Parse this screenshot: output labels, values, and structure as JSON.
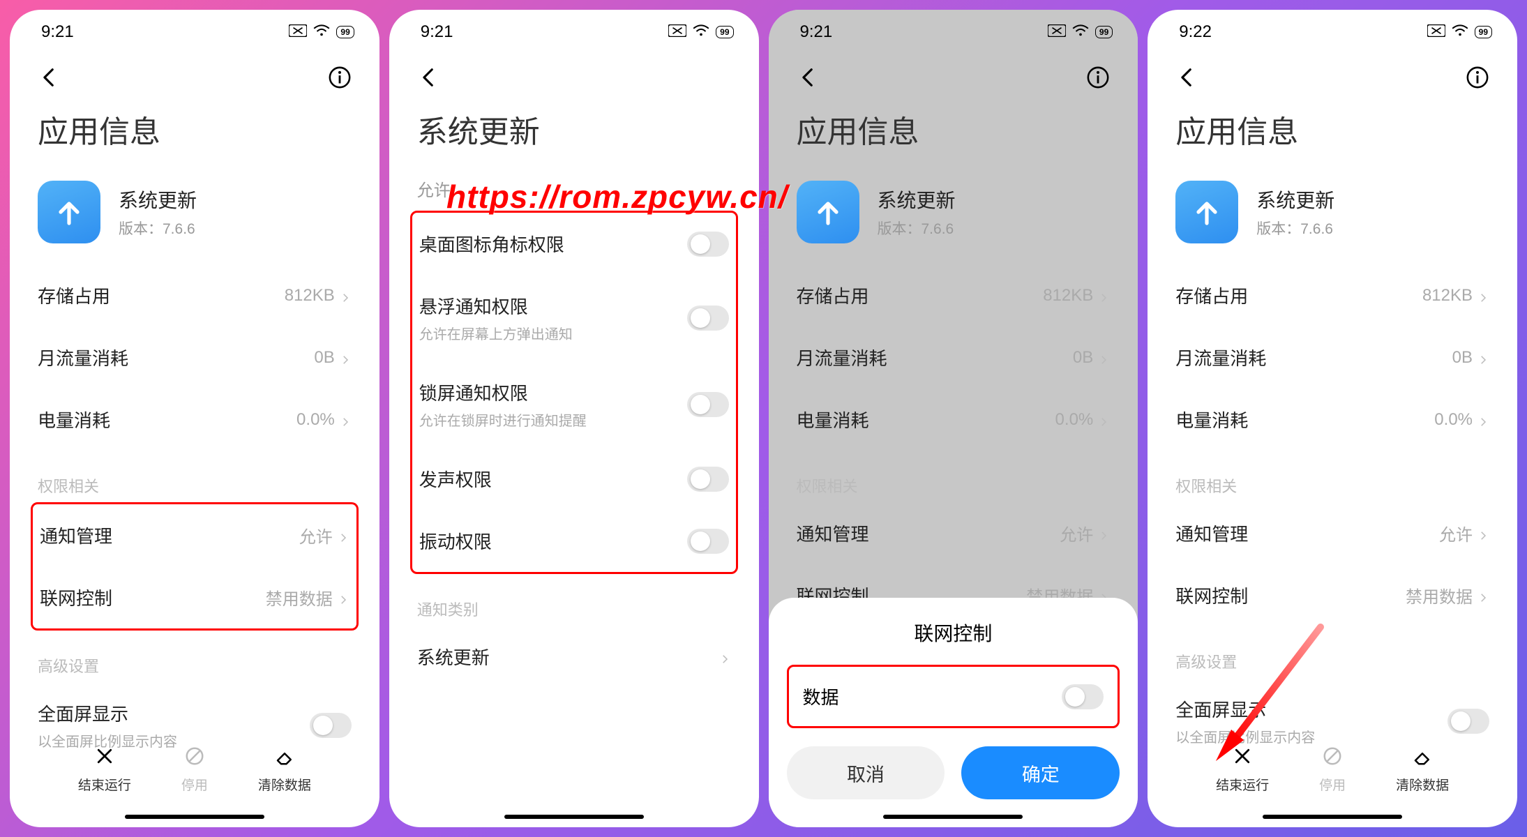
{
  "watermark": "https://rom.zpcyw.cn/",
  "statusbar": {
    "time_921": "9:21",
    "time_922": "9:22",
    "battery": "99"
  },
  "appinfo": {
    "title": "应用信息",
    "app_name": "系统更新",
    "version_label": "版本：7.6.6",
    "rows": {
      "storage": {
        "label": "存储占用",
        "value": "812KB"
      },
      "data": {
        "label": "月流量消耗",
        "value": "0B"
      },
      "power": {
        "label": "电量消耗",
        "value": "0.0%"
      }
    },
    "perm_section": "权限相关",
    "perm": {
      "notify": {
        "label": "通知管理",
        "value": "允许"
      },
      "net": {
        "label": "联网控制",
        "value": "禁用数据"
      }
    },
    "adv_section": "高级设置",
    "fullscreen": {
      "label": "全面屏显示",
      "sub": "以全面屏比例显示内容"
    },
    "actions": {
      "stop": "结束运行",
      "disable": "停用",
      "clear": "清除数据"
    }
  },
  "sysupdate": {
    "title": "系统更新",
    "allow_prefix": "允许",
    "toggles": {
      "badge": {
        "label": "桌面图标角标权限"
      },
      "float": {
        "label": "悬浮通知权限",
        "sub": "允许在屏幕上方弹出通知"
      },
      "lock": {
        "label": "锁屏通知权限",
        "sub": "允许在锁屏时进行通知提醒"
      },
      "sound": {
        "label": "发声权限"
      },
      "vibra": {
        "label": "振动权限"
      }
    },
    "cat_section": "通知类别",
    "cat_row": "系统更新"
  },
  "sheet": {
    "title": "联网控制",
    "row_label": "数据",
    "cancel": "取消",
    "ok": "确定"
  }
}
